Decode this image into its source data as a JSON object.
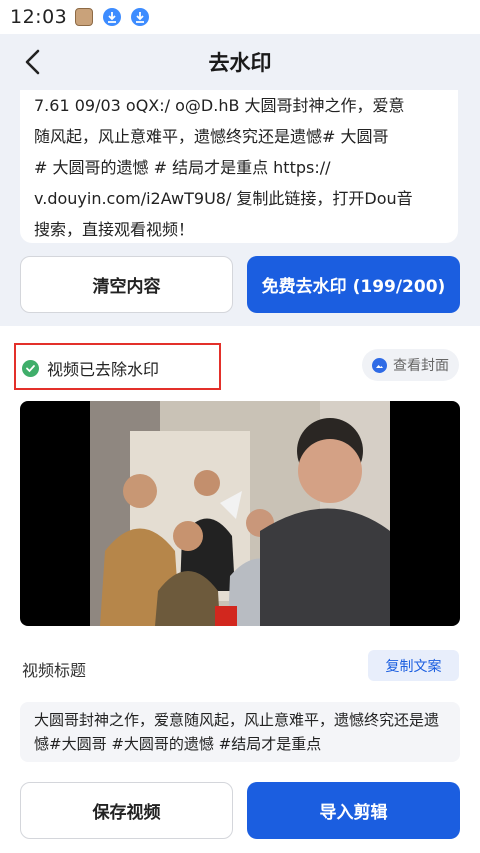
{
  "status_bar": {
    "time": "12:03",
    "icons": [
      "app-avatar-icon",
      "download-icon",
      "download-icon"
    ]
  },
  "nav": {
    "title": "去水印",
    "back_icon": "chevron-left-icon"
  },
  "share_text": {
    "lines": [
      "7.61 09/03 oQX:/ o@D.hB 大圆哥封神之作，爱意",
      "随风起，风止意难平，遗憾终究还是遗憾# 大圆哥",
      "# 大圆哥的遗憾 # 结局才是重点  https://",
      "v.douyin.com/i2AwT9U8/ 复制此链接，打开Dou音",
      "搜索，直接观看视频！"
    ]
  },
  "actions": {
    "clear_label": "清空内容",
    "remove_label": "免费去水印 (199/200)"
  },
  "result": {
    "status_text": "视频已去除水印",
    "status_icon": "check-circle-icon",
    "cover_label": "查看封面",
    "cover_icon": "image-icon"
  },
  "video_title": {
    "label": "视频标题",
    "copy_label": "复制文案",
    "text": "大圆哥封神之作，爱意随风起，风止意难平，遗憾终究还是遗憾#大圆哥 #大圆哥的遗憾 #结局才是重点"
  },
  "bottom_actions": {
    "save_label": "保存视频",
    "import_label": "导入剪辑"
  },
  "colors": {
    "primary": "#1b5ee0",
    "highlight_border": "#e3302a",
    "success": "#3fae6a"
  }
}
